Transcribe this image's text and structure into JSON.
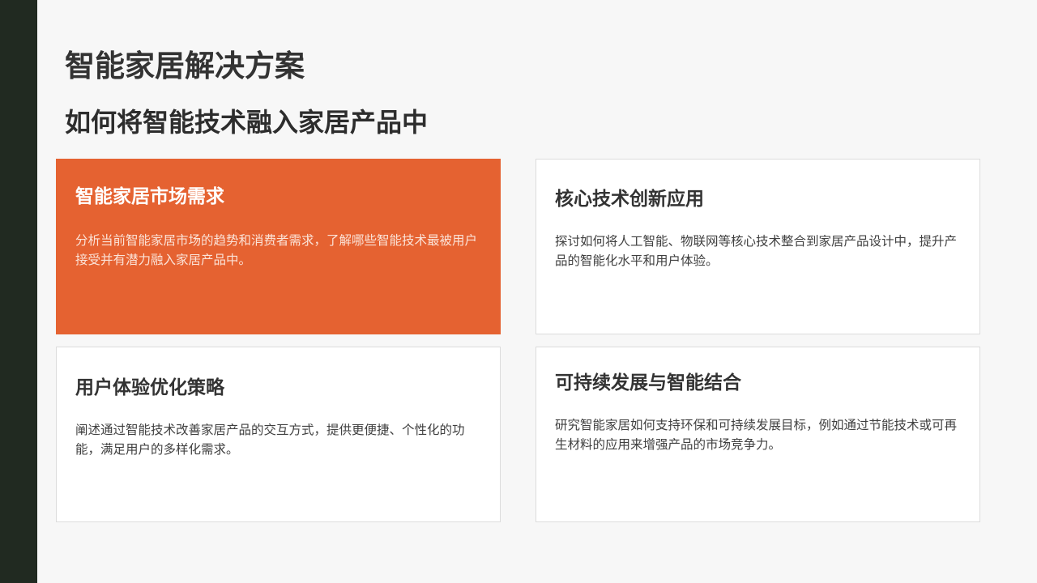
{
  "slide": {
    "title": "智能家居解决方案",
    "subtitle": "如何将智能技术融入家居产品中",
    "colors": {
      "background": "#f7f7f7",
      "sidebar": "#212a21",
      "accent": "#e56231",
      "card": "#ffffff",
      "text": "#333333"
    }
  },
  "cards": [
    {
      "title": "智能家居市场需求",
      "body": "分析当前智能家居市场的趋势和消费者需求，了解哪些智能技术最被用户接受并有潜力融入家居产品中。",
      "highlighted": true
    },
    {
      "title": "核心技术创新应用",
      "body": "探讨如何将人工智能、物联网等核心技术整合到家居产品设计中，提升产品的智能化水平和用户体验。",
      "highlighted": false
    },
    {
      "title": "用户体验优化策略",
      "body": "阐述通过智能技术改善家居产品的交互方式，提供更便捷、个性化的功能，满足用户的多样化需求。",
      "highlighted": false
    },
    {
      "title": "可持续发展与智能结合",
      "body": "研究智能家居如何支持环保和可持续发展目标，例如通过节能技术或可再生材料的应用来增强产品的市场竞争力。",
      "highlighted": false
    }
  ]
}
